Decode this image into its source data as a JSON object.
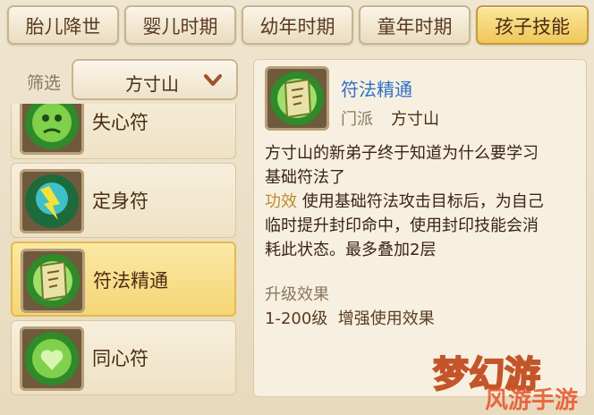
{
  "tabs": [
    {
      "label": "胎儿降世",
      "active": false
    },
    {
      "label": "婴儿时期",
      "active": false
    },
    {
      "label": "幼年时期",
      "active": false
    },
    {
      "label": "童年时期",
      "active": false
    },
    {
      "label": "孩子技能",
      "active": true
    }
  ],
  "filter": {
    "label": "筛选",
    "value": "方寸山"
  },
  "skills": [
    {
      "name": "失心符",
      "icon": "talisman-face-icon"
    },
    {
      "name": "定身符",
      "icon": "lightning-figure-icon"
    },
    {
      "name": "符法精通",
      "icon": "scroll-talisman-icon",
      "selected": true
    },
    {
      "name": "同心符",
      "icon": "heart-figure-icon"
    }
  ],
  "detail": {
    "title": "符法精通",
    "school_label": "门派",
    "school": "方寸山",
    "description": "方寸山的新弟子终于知道为什么要学习基础符法了",
    "effect_label": "功效",
    "effect_line1": "使用基础符法攻击目标后，为自己",
    "effect_line2": "临时提升封印命中，使用封印技能会消",
    "effect_line3": "耗此状态。最多叠加2层",
    "upgrade_label": "升级效果",
    "upgrade_range": "1-200级",
    "upgrade_text": "增强使用效果",
    "desc_line1": "方寸山的新弟子终于知道为什么要学习",
    "desc_line2": "基础符法了"
  },
  "watermark": {
    "text": "梦幻游",
    "sub": "风游手游"
  },
  "colors": {
    "accent": "#f0c75a",
    "link": "#2f6fc9",
    "gold": "#c08a2c"
  }
}
